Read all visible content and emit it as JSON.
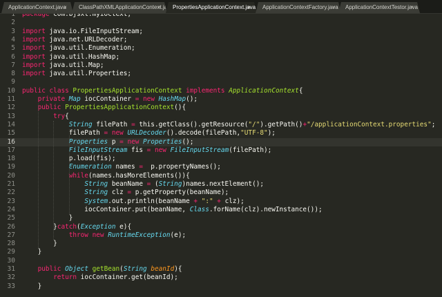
{
  "tabs": [
    {
      "label": "ApplicationContext.java",
      "close": "×",
      "active": false
    },
    {
      "label": "ClassPathXMLApplicationContext.java",
      "close": "×",
      "active": false
    },
    {
      "label": "PropertiesApplicationContext.java",
      "close": "×",
      "active": true
    },
    {
      "label": "ApplicationContextFactory.java",
      "close": "×",
      "active": false
    },
    {
      "label": "ApplicationContextTestor.java",
      "close": "×",
      "active": false
    }
  ],
  "current_line": 16,
  "lines": [
    {
      "n": "1",
      "tokens": [
        [
          "k",
          "package"
        ],
        [
          "n",
          " com.bjsxt.myioctext;"
        ]
      ]
    },
    {
      "n": "2",
      "tokens": []
    },
    {
      "n": "3",
      "tokens": [
        [
          "k",
          "import"
        ],
        [
          "n",
          " java.io.FileInputStream;"
        ]
      ]
    },
    {
      "n": "4",
      "tokens": [
        [
          "k",
          "import"
        ],
        [
          "n",
          " java.net.URLDecoder;"
        ]
      ]
    },
    {
      "n": "5",
      "tokens": [
        [
          "k",
          "import"
        ],
        [
          "n",
          " java.util.Enumeration;"
        ]
      ]
    },
    {
      "n": "6",
      "tokens": [
        [
          "k",
          "import"
        ],
        [
          "n",
          " java.util.HashMap;"
        ]
      ]
    },
    {
      "n": "7",
      "tokens": [
        [
          "k",
          "import"
        ],
        [
          "n",
          " java.util.Map;"
        ]
      ]
    },
    {
      "n": "8",
      "tokens": [
        [
          "k",
          "import"
        ],
        [
          "n",
          " java.util.Properties;"
        ]
      ]
    },
    {
      "n": "9",
      "tokens": []
    },
    {
      "n": "10",
      "tokens": [
        [
          "k",
          "public"
        ],
        [
          "n",
          " "
        ],
        [
          "k",
          "class"
        ],
        [
          "n",
          " "
        ],
        [
          "f",
          "PropertiesApplicationContext"
        ],
        [
          "n",
          " "
        ],
        [
          "k",
          "implements"
        ],
        [
          "n",
          " "
        ],
        [
          "i",
          "ApplicationContext"
        ],
        [
          "n",
          "{"
        ]
      ]
    },
    {
      "n": "11",
      "tokens": [
        [
          "n",
          "    "
        ],
        [
          "k",
          "private"
        ],
        [
          "n",
          " "
        ],
        [
          "t",
          "Map"
        ],
        [
          "n",
          " iocContainer "
        ],
        [
          "k",
          "="
        ],
        [
          "n",
          " "
        ],
        [
          "k",
          "new"
        ],
        [
          "n",
          " "
        ],
        [
          "t",
          "HashMap"
        ],
        [
          "n",
          "();"
        ]
      ]
    },
    {
      "n": "12",
      "tokens": [
        [
          "n",
          "    "
        ],
        [
          "k",
          "public"
        ],
        [
          "n",
          " "
        ],
        [
          "f",
          "PropertiesApplicationContext"
        ],
        [
          "n",
          "(){"
        ]
      ]
    },
    {
      "n": "13",
      "tokens": [
        [
          "n",
          "        "
        ],
        [
          "k",
          "try"
        ],
        [
          "n",
          "{"
        ]
      ]
    },
    {
      "n": "14",
      "tokens": [
        [
          "n",
          "            "
        ],
        [
          "t",
          "String"
        ],
        [
          "n",
          " filePath "
        ],
        [
          "k",
          "="
        ],
        [
          "n",
          " this.getClass().getResource("
        ],
        [
          "s",
          "\"/\""
        ],
        [
          "n",
          ").getPath()"
        ],
        [
          "k",
          "+"
        ],
        [
          "s",
          "\"/applicationContext.properties\""
        ],
        [
          "n",
          ";"
        ]
      ]
    },
    {
      "n": "15",
      "tokens": [
        [
          "n",
          "            filePath "
        ],
        [
          "k",
          "="
        ],
        [
          "n",
          " "
        ],
        [
          "k",
          "new"
        ],
        [
          "n",
          " "
        ],
        [
          "t",
          "URLDecoder"
        ],
        [
          "n",
          "().decode(filePath,"
        ],
        [
          "s",
          "\"UTF-8\""
        ],
        [
          "n",
          ");"
        ]
      ]
    },
    {
      "n": "16",
      "tokens": [
        [
          "n",
          "            "
        ],
        [
          "t",
          "Properties"
        ],
        [
          "n",
          " p "
        ],
        [
          "k",
          "="
        ],
        [
          "n",
          " "
        ],
        [
          "k",
          "new"
        ],
        [
          "n",
          " "
        ],
        [
          "t",
          "Properties"
        ],
        [
          "n",
          "();"
        ]
      ]
    },
    {
      "n": "17",
      "tokens": [
        [
          "n",
          "            "
        ],
        [
          "t",
          "FileInputStream"
        ],
        [
          "n",
          " fis "
        ],
        [
          "k",
          "="
        ],
        [
          "n",
          " "
        ],
        [
          "k",
          "new"
        ],
        [
          "n",
          " "
        ],
        [
          "t",
          "FileInputStream"
        ],
        [
          "n",
          "(filePath);"
        ]
      ]
    },
    {
      "n": "18",
      "tokens": [
        [
          "n",
          "            p.load(fis);"
        ]
      ]
    },
    {
      "n": "19",
      "tokens": [
        [
          "n",
          "            "
        ],
        [
          "t",
          "Enumeration"
        ],
        [
          "n",
          " names "
        ],
        [
          "k",
          "="
        ],
        [
          "n",
          "  p.propertyNames();"
        ]
      ]
    },
    {
      "n": "20",
      "tokens": [
        [
          "n",
          "            "
        ],
        [
          "k",
          "while"
        ],
        [
          "n",
          "(names.hasMoreElements()){"
        ]
      ]
    },
    {
      "n": "21",
      "tokens": [
        [
          "n",
          "                "
        ],
        [
          "t",
          "String"
        ],
        [
          "n",
          " beanName "
        ],
        [
          "k",
          "="
        ],
        [
          "n",
          " ("
        ],
        [
          "t",
          "String"
        ],
        [
          "n",
          ")names.nextElement();"
        ]
      ]
    },
    {
      "n": "22",
      "tokens": [
        [
          "n",
          "                "
        ],
        [
          "t",
          "String"
        ],
        [
          "n",
          " clz "
        ],
        [
          "k",
          "="
        ],
        [
          "n",
          " p.getProperty(beanName);"
        ]
      ]
    },
    {
      "n": "23",
      "tokens": [
        [
          "n",
          "                "
        ],
        [
          "t",
          "System"
        ],
        [
          "n",
          ".out.println(beanName "
        ],
        [
          "k",
          "+"
        ],
        [
          "n",
          " "
        ],
        [
          "s",
          "\":\""
        ],
        [
          "n",
          " "
        ],
        [
          "k",
          "+"
        ],
        [
          "n",
          " clz);"
        ]
      ]
    },
    {
      "n": "24",
      "tokens": [
        [
          "n",
          "                iocContainer.put(beanName, "
        ],
        [
          "t",
          "Class"
        ],
        [
          "n",
          ".forName(clz).newInstance());"
        ]
      ]
    },
    {
      "n": "25",
      "tokens": [
        [
          "n",
          "            }"
        ]
      ]
    },
    {
      "n": "26",
      "tokens": [
        [
          "n",
          "        }"
        ],
        [
          "k",
          "catch"
        ],
        [
          "n",
          "("
        ],
        [
          "t",
          "Exception"
        ],
        [
          "n",
          " e){"
        ]
      ]
    },
    {
      "n": "27",
      "tokens": [
        [
          "n",
          "            "
        ],
        [
          "k",
          "throw"
        ],
        [
          "n",
          " "
        ],
        [
          "k",
          "new"
        ],
        [
          "n",
          " "
        ],
        [
          "t",
          "RuntimeException"
        ],
        [
          "n",
          "(e);"
        ]
      ]
    },
    {
      "n": "28",
      "tokens": [
        [
          "n",
          "        }"
        ]
      ]
    },
    {
      "n": "29",
      "tokens": [
        [
          "n",
          "    }"
        ]
      ]
    },
    {
      "n": "30",
      "tokens": []
    },
    {
      "n": "31",
      "tokens": [
        [
          "n",
          "    "
        ],
        [
          "k",
          "public"
        ],
        [
          "n",
          " "
        ],
        [
          "t",
          "Object"
        ],
        [
          "n",
          " "
        ],
        [
          "f",
          "getBean"
        ],
        [
          "n",
          "("
        ],
        [
          "t",
          "String"
        ],
        [
          "n",
          " "
        ],
        [
          "p",
          "beanId"
        ],
        [
          "n",
          "){"
        ]
      ]
    },
    {
      "n": "32",
      "tokens": [
        [
          "n",
          "        "
        ],
        [
          "k",
          "return"
        ],
        [
          "n",
          " iocContainer.get(beanId);"
        ]
      ]
    },
    {
      "n": "33",
      "tokens": [
        [
          "n",
          "    }"
        ]
      ]
    }
  ],
  "icons": {
    "tab_close": "close-icon"
  }
}
